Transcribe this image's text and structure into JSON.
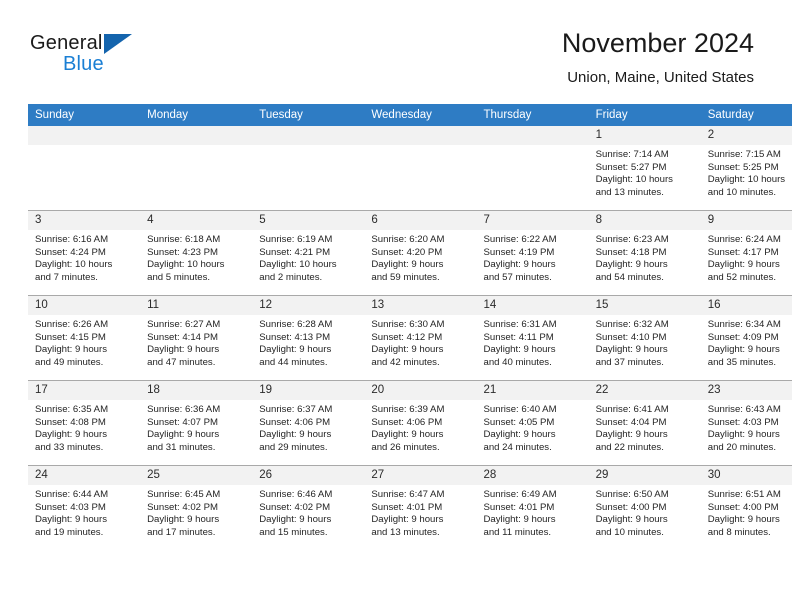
{
  "brand": {
    "name_top": "General",
    "name_bottom": "Blue",
    "triangle_icon": "triangle-icon",
    "accent_color": "#1a7fd4"
  },
  "header": {
    "title": "November 2024",
    "location": "Union, Maine, United States"
  },
  "theme": {
    "header_bg": "#2e7cc4",
    "daynum_bg": "#f2f2f2",
    "grid_line": "#a9a9a9",
    "text": "#242424"
  },
  "calendar": {
    "weekdays": [
      "Sunday",
      "Monday",
      "Tuesday",
      "Wednesday",
      "Thursday",
      "Friday",
      "Saturday"
    ],
    "weeks": [
      [
        {
          "day": "",
          "lines": []
        },
        {
          "day": "",
          "lines": []
        },
        {
          "day": "",
          "lines": []
        },
        {
          "day": "",
          "lines": []
        },
        {
          "day": "",
          "lines": []
        },
        {
          "day": "1",
          "lines": [
            "Sunrise: 7:14 AM",
            "Sunset: 5:27 PM",
            "Daylight: 10 hours",
            "and 13 minutes."
          ]
        },
        {
          "day": "2",
          "lines": [
            "Sunrise: 7:15 AM",
            "Sunset: 5:25 PM",
            "Daylight: 10 hours",
            "and 10 minutes."
          ]
        }
      ],
      [
        {
          "day": "3",
          "lines": [
            "Sunrise: 6:16 AM",
            "Sunset: 4:24 PM",
            "Daylight: 10 hours",
            "and 7 minutes."
          ]
        },
        {
          "day": "4",
          "lines": [
            "Sunrise: 6:18 AM",
            "Sunset: 4:23 PM",
            "Daylight: 10 hours",
            "and 5 minutes."
          ]
        },
        {
          "day": "5",
          "lines": [
            "Sunrise: 6:19 AM",
            "Sunset: 4:21 PM",
            "Daylight: 10 hours",
            "and 2 minutes."
          ]
        },
        {
          "day": "6",
          "lines": [
            "Sunrise: 6:20 AM",
            "Sunset: 4:20 PM",
            "Daylight: 9 hours",
            "and 59 minutes."
          ]
        },
        {
          "day": "7",
          "lines": [
            "Sunrise: 6:22 AM",
            "Sunset: 4:19 PM",
            "Daylight: 9 hours",
            "and 57 minutes."
          ]
        },
        {
          "day": "8",
          "lines": [
            "Sunrise: 6:23 AM",
            "Sunset: 4:18 PM",
            "Daylight: 9 hours",
            "and 54 minutes."
          ]
        },
        {
          "day": "9",
          "lines": [
            "Sunrise: 6:24 AM",
            "Sunset: 4:17 PM",
            "Daylight: 9 hours",
            "and 52 minutes."
          ]
        }
      ],
      [
        {
          "day": "10",
          "lines": [
            "Sunrise: 6:26 AM",
            "Sunset: 4:15 PM",
            "Daylight: 9 hours",
            "and 49 minutes."
          ]
        },
        {
          "day": "11",
          "lines": [
            "Sunrise: 6:27 AM",
            "Sunset: 4:14 PM",
            "Daylight: 9 hours",
            "and 47 minutes."
          ]
        },
        {
          "day": "12",
          "lines": [
            "Sunrise: 6:28 AM",
            "Sunset: 4:13 PM",
            "Daylight: 9 hours",
            "and 44 minutes."
          ]
        },
        {
          "day": "13",
          "lines": [
            "Sunrise: 6:30 AM",
            "Sunset: 4:12 PM",
            "Daylight: 9 hours",
            "and 42 minutes."
          ]
        },
        {
          "day": "14",
          "lines": [
            "Sunrise: 6:31 AM",
            "Sunset: 4:11 PM",
            "Daylight: 9 hours",
            "and 40 minutes."
          ]
        },
        {
          "day": "15",
          "lines": [
            "Sunrise: 6:32 AM",
            "Sunset: 4:10 PM",
            "Daylight: 9 hours",
            "and 37 minutes."
          ]
        },
        {
          "day": "16",
          "lines": [
            "Sunrise: 6:34 AM",
            "Sunset: 4:09 PM",
            "Daylight: 9 hours",
            "and 35 minutes."
          ]
        }
      ],
      [
        {
          "day": "17",
          "lines": [
            "Sunrise: 6:35 AM",
            "Sunset: 4:08 PM",
            "Daylight: 9 hours",
            "and 33 minutes."
          ]
        },
        {
          "day": "18",
          "lines": [
            "Sunrise: 6:36 AM",
            "Sunset: 4:07 PM",
            "Daylight: 9 hours",
            "and 31 minutes."
          ]
        },
        {
          "day": "19",
          "lines": [
            "Sunrise: 6:37 AM",
            "Sunset: 4:06 PM",
            "Daylight: 9 hours",
            "and 29 minutes."
          ]
        },
        {
          "day": "20",
          "lines": [
            "Sunrise: 6:39 AM",
            "Sunset: 4:06 PM",
            "Daylight: 9 hours",
            "and 26 minutes."
          ]
        },
        {
          "day": "21",
          "lines": [
            "Sunrise: 6:40 AM",
            "Sunset: 4:05 PM",
            "Daylight: 9 hours",
            "and 24 minutes."
          ]
        },
        {
          "day": "22",
          "lines": [
            "Sunrise: 6:41 AM",
            "Sunset: 4:04 PM",
            "Daylight: 9 hours",
            "and 22 minutes."
          ]
        },
        {
          "day": "23",
          "lines": [
            "Sunrise: 6:43 AM",
            "Sunset: 4:03 PM",
            "Daylight: 9 hours",
            "and 20 minutes."
          ]
        }
      ],
      [
        {
          "day": "24",
          "lines": [
            "Sunrise: 6:44 AM",
            "Sunset: 4:03 PM",
            "Daylight: 9 hours",
            "and 19 minutes."
          ]
        },
        {
          "day": "25",
          "lines": [
            "Sunrise: 6:45 AM",
            "Sunset: 4:02 PM",
            "Daylight: 9 hours",
            "and 17 minutes."
          ]
        },
        {
          "day": "26",
          "lines": [
            "Sunrise: 6:46 AM",
            "Sunset: 4:02 PM",
            "Daylight: 9 hours",
            "and 15 minutes."
          ]
        },
        {
          "day": "27",
          "lines": [
            "Sunrise: 6:47 AM",
            "Sunset: 4:01 PM",
            "Daylight: 9 hours",
            "and 13 minutes."
          ]
        },
        {
          "day": "28",
          "lines": [
            "Sunrise: 6:49 AM",
            "Sunset: 4:01 PM",
            "Daylight: 9 hours",
            "and 11 minutes."
          ]
        },
        {
          "day": "29",
          "lines": [
            "Sunrise: 6:50 AM",
            "Sunset: 4:00 PM",
            "Daylight: 9 hours",
            "and 10 minutes."
          ]
        },
        {
          "day": "30",
          "lines": [
            "Sunrise: 6:51 AM",
            "Sunset: 4:00 PM",
            "Daylight: 9 hours",
            "and 8 minutes."
          ]
        }
      ]
    ]
  }
}
